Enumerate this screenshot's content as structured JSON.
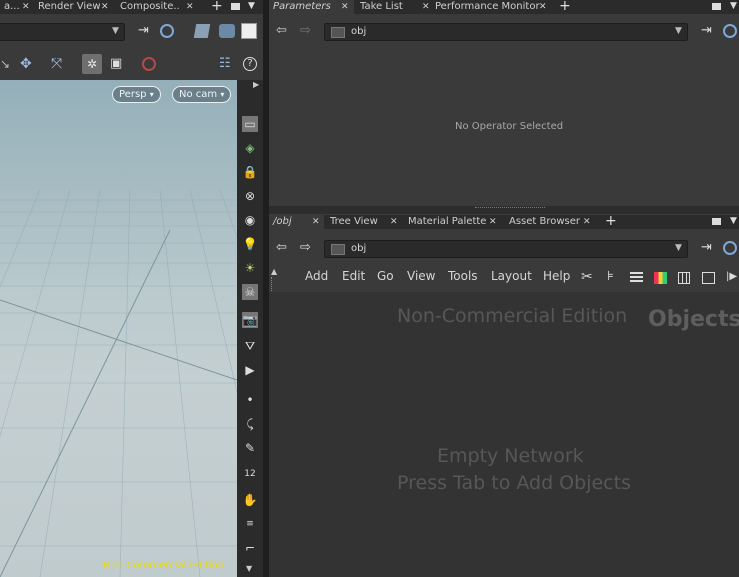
{
  "left_pane": {
    "tabs": [
      {
        "label": "a..."
      },
      {
        "label": "Render View"
      },
      {
        "label": "Composite..."
      }
    ],
    "viewport": {
      "persp_label": "Persp",
      "cam_label": "No cam",
      "watermark": "Non-Commercial Edition"
    }
  },
  "parameters_pane": {
    "tabs": [
      {
        "label": "Parameters"
      },
      {
        "label": "Take List"
      },
      {
        "label": "Performance Monitor"
      }
    ],
    "path": "obj",
    "empty_message": "No Operator Selected"
  },
  "network_pane": {
    "tabs": [
      {
        "label": "/obj"
      },
      {
        "label": "Tree View"
      },
      {
        "label": "Material Palette"
      },
      {
        "label": "Asset Browser"
      }
    ],
    "path": "obj",
    "menu": [
      "Add",
      "Edit",
      "Go",
      "View",
      "Tools",
      "Layout",
      "Help"
    ],
    "watermark": "Non-Commercial Edition",
    "context_label": "Objects",
    "empty_line1": "Empty Network",
    "empty_line2": "Press Tab to Add Objects"
  },
  "colors": {
    "watermark_yellow": "#e6d817",
    "panel_bg": "#3a3a3a",
    "tab_bg": "#2b2b2b"
  }
}
